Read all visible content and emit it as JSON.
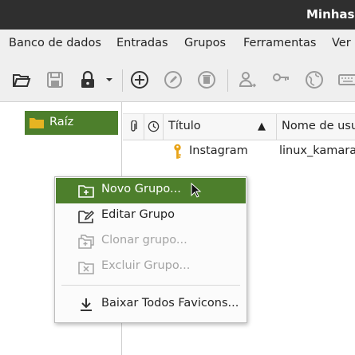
{
  "window": {
    "title": "Minhas S"
  },
  "menu": [
    "Banco de dados",
    "Entradas",
    "Grupos",
    "Ferramentas",
    "Ver"
  ],
  "toolbar": {
    "icons": [
      "open-database-icon",
      "save-database-icon",
      "lock-database-icon",
      "add-entry-icon",
      "edit-entry-icon",
      "delete-entry-icon",
      "copy-username-icon",
      "copy-password-icon",
      "open-url-icon",
      "autotype-icon"
    ]
  },
  "groups": {
    "root_label": "Raíz"
  },
  "table": {
    "columns": [
      "Título",
      "Nome de usu"
    ],
    "sort_indicator": "▲",
    "rows": [
      {
        "title": "Instagram",
        "username": "linux_kamarad"
      }
    ]
  },
  "context_menu": {
    "items": [
      {
        "label": "Novo Grupo...",
        "icon": "new-group-icon",
        "state": "active"
      },
      {
        "label": "Editar Grupo",
        "icon": "edit-group-icon",
        "state": "enabled"
      },
      {
        "label": "Clonar grupo...",
        "icon": "clone-group-icon",
        "state": "disabled"
      },
      {
        "label": "Excluir Grupo...",
        "icon": "delete-group-icon",
        "state": "disabled"
      },
      {
        "label": "Baixar Todos Favicons...",
        "icon": "download-icon",
        "state": "enabled"
      }
    ]
  },
  "colors": {
    "accent": "#4d7f2c",
    "titlebar": "#2f2f2f",
    "key_icon": "#e8a317"
  }
}
